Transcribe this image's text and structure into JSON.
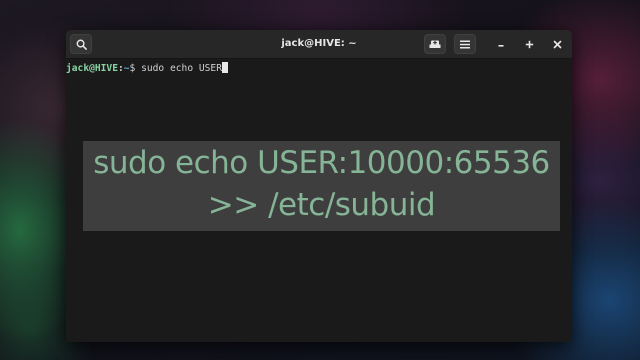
{
  "window": {
    "title": "jack@HIVE: ~"
  },
  "toolbar": {
    "search_icon": "search-icon",
    "new_tab_icon": "new-tab-icon",
    "menu_icon": "hamburger-menu-icon",
    "minimize_icon": "minimize-icon",
    "maximize_icon": "maximize-icon",
    "close_icon": "close-icon"
  },
  "terminal": {
    "prompt_user_host": "jack@HIVE",
    "prompt_separator": ":",
    "prompt_path": "~",
    "prompt_symbol": "$",
    "command": "sudo echo USER"
  },
  "overlay": {
    "line1": "sudo echo USER:10000:65536",
    "line2": ">> /etc/subuid"
  },
  "colors": {
    "prompt_user": "#8ad4a4",
    "prompt_path": "#6aa6dc",
    "overlay_text": "#86b497",
    "overlay_bg": "#3e3e3e",
    "terminal_bg": "#1a1a1a",
    "titlebar_bg": "#272727"
  }
}
